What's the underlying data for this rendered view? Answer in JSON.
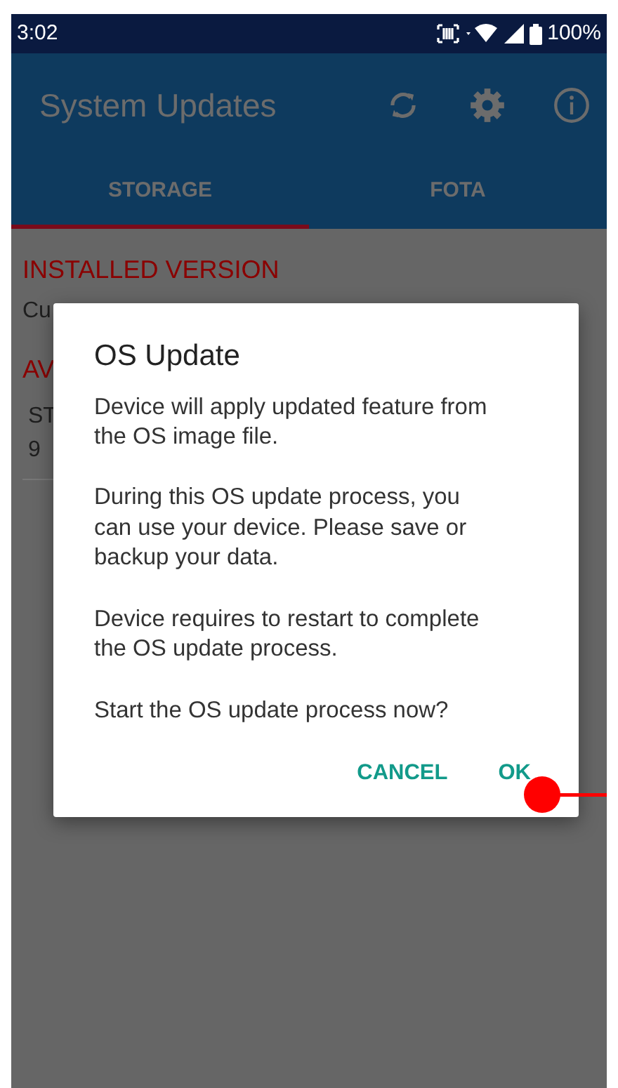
{
  "status_bar": {
    "time": "3:02",
    "battery": "100%"
  },
  "app_bar": {
    "title": "System Updates"
  },
  "tabs": [
    {
      "label": "STORAGE",
      "selected": true
    },
    {
      "label": "FOTA",
      "selected": false
    }
  ],
  "content": {
    "installed_heading": "INSTALLED VERSION",
    "installed_text": "Cu",
    "available_heading": "AV",
    "item_label": "ST",
    "item_value": "9"
  },
  "dialog": {
    "title": "OS Update",
    "paragraphs": [
      "Device will apply updated feature from the OS image file.",
      "During this OS update process, you can use your device. Please save or backup your data.",
      "Device requires to restart to complete the OS update process.",
      "Start the OS update process now?"
    ],
    "buttons": [
      "CANCEL",
      "OK"
    ]
  }
}
